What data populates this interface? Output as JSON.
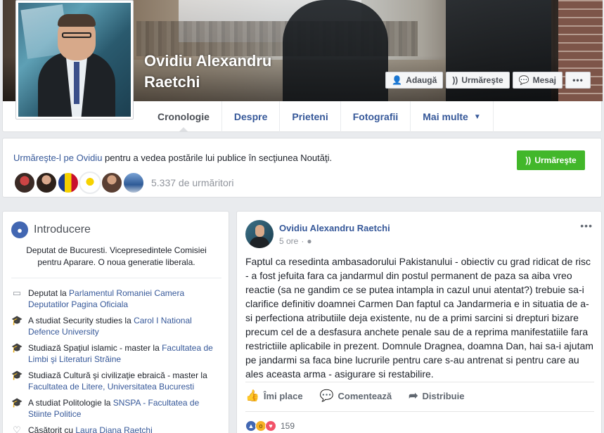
{
  "profile": {
    "name": "Ovidiu Alexandru Raetchi"
  },
  "cover_actions": {
    "add_label": "Adaugă",
    "follow_label": "Urmăreşte",
    "message_label": "Mesaj",
    "more_label": "•••"
  },
  "tabs": [
    {
      "label": "Cronologie"
    },
    {
      "label": "Despre"
    },
    {
      "label": "Prieteni"
    },
    {
      "label": "Fotografii"
    },
    {
      "label": "Mai multe"
    }
  ],
  "follow_bar": {
    "link_text": "Urmăreşte-l pe Ovidiu",
    "rest_text": " pentru a vedea postările lui publice în secţiunea Noutăţi.",
    "button_label": "Urmăreşte",
    "follower_count": "5.337 de urmăritori",
    "avatar_colors": [
      "#7a2e2e",
      "#3d2a22",
      "#c2342f",
      "#ffffff",
      "#8a5a48",
      "#4b6fa8"
    ]
  },
  "intro": {
    "title": "Introducere",
    "bio": "Deputat de Bucuresti. Vicepresedintele Comisiei pentru Aparare. O noua generatie liberala.",
    "items": [
      {
        "icon": "briefcase-icon",
        "prefix": "Deputat la ",
        "link": "Parlamentul Romaniei Camera Deputatilor Pagina Oficiala",
        "suffix": ""
      },
      {
        "icon": "graduation-cap-icon",
        "prefix": "A studiat Security studies la ",
        "link": "Carol I National Defence University",
        "suffix": ""
      },
      {
        "icon": "graduation-cap-icon",
        "prefix": "Studiază Spaţiul islamic - master la ",
        "link": "Facultatea de Limbi şi Literaturi Străine",
        "suffix": ""
      },
      {
        "icon": "graduation-cap-icon",
        "prefix": "Studiază Cultură şi civilizaţie ebraică - master la ",
        "link": "Facultatea de Litere, Universitatea Bucuresti",
        "suffix": ""
      },
      {
        "icon": "graduation-cap-icon",
        "prefix": "A studiat Politologie la ",
        "link": "SNSPA - Facultatea de Stiinte Politice",
        "suffix": ""
      },
      {
        "icon": "heart-icon",
        "prefix": "Căsătorit cu ",
        "link": "Laura Diana Raetchi",
        "suffix": ""
      }
    ]
  },
  "post": {
    "author": "Ovidiu Alexandru Raetchi",
    "time": "5 ore",
    "text": "Faptul ca resedinta ambasadorului Pakistanului - obiectiv cu grad ridicat de risc - a fost jefuita fara ca jandarmul din postul permanent de paza sa aiba vreo reactie (sa ne gandim ce se putea intampla in cazul unui atentat?) trebuie sa-i clarifice definitiv doamnei Carmen Dan faptul ca Jandarmeria e in situatia de a-si perfectiona atributiile deja existente, nu de a primi sarcini si drepturi bizare precum cel de a desfasura anchete penale sau de a reprima manifestatiile fara restrictiile aplicabile in prezent. Domnule Dragnea, doamna Dan, hai sa-i ajutam pe jandarmi sa faca bine lucrurile pentru care s-au antrenat si pentru care au ales aceasta arma - asigurare si restabilire.",
    "actions": {
      "like": "Îmi place",
      "comment": "Comentează",
      "share": "Distribuie"
    },
    "reaction_count": "159"
  }
}
